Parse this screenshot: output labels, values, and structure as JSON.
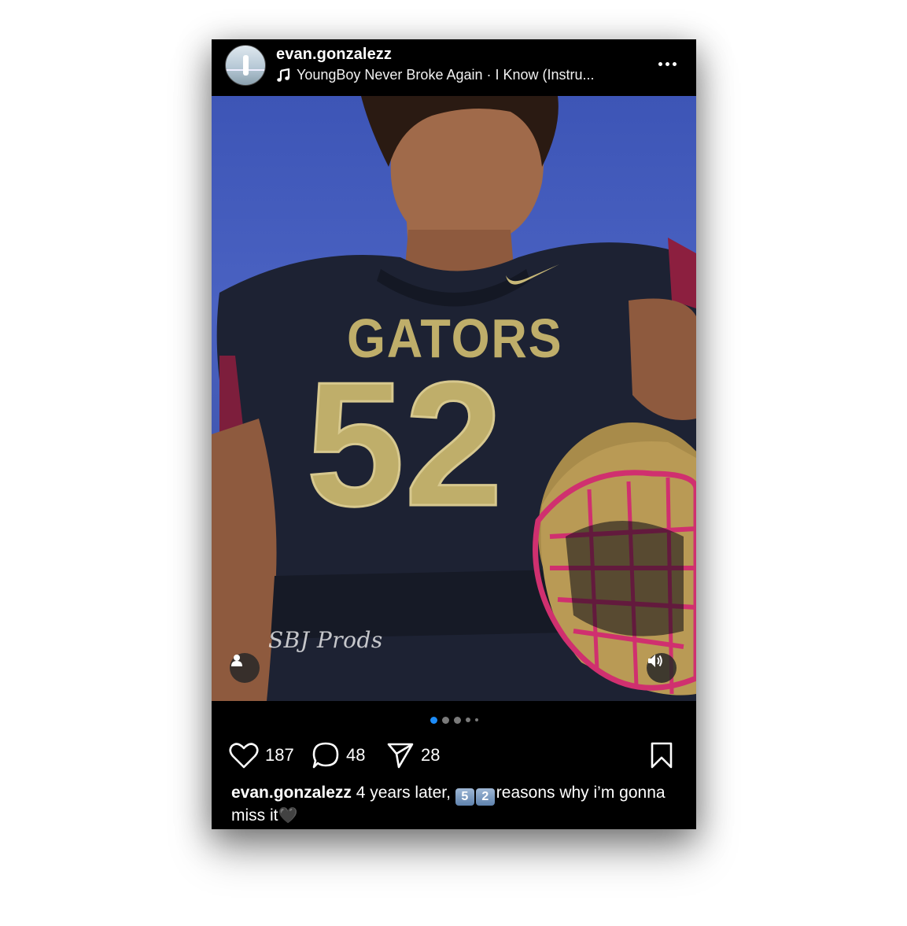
{
  "post": {
    "username": "evan.gonzalezz",
    "music": "YoungBoy Never Broke Again · I Know (Instru...",
    "watermark": "SBJ Prods",
    "jersey_text": "GATORS",
    "jersey_number": "52",
    "likes": "187",
    "comments": "48",
    "shares": "28",
    "carousel": {
      "count": 5,
      "active_index": 0
    },
    "caption": {
      "username": "evan.gonzalezz",
      "text_before": " 4 years later, ",
      "emoji_keys": [
        "5",
        "2"
      ],
      "text_after": "reasons why i’m gonna miss it",
      "end_emoji": "🖤"
    }
  },
  "icons": {
    "music": "music-note-icon",
    "more": "more-options-icon",
    "tag": "user-tag-icon",
    "sound": "speaker-icon",
    "like": "heart-icon",
    "comment": "comment-icon",
    "share": "send-icon",
    "save": "bookmark-icon"
  },
  "colors": {
    "accent": "#1d8cf8",
    "background": "#000000",
    "jersey_gold": "#bfae6a",
    "maroon": "#8c1f3f"
  }
}
